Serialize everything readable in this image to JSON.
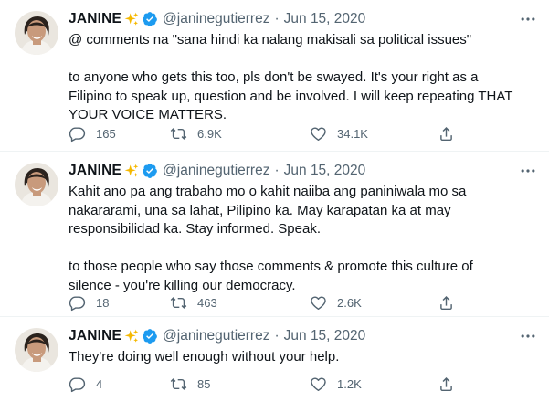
{
  "tweets": [
    {
      "name": "JANINE",
      "handle": "@janinegutierrez",
      "separator": "·",
      "date": "Jun 15, 2020",
      "lines": [
        "@ comments na \"sana hindi ka nalang makisali sa political issues\"",
        "",
        "to anyone who gets this too, pls don't be swayed. It's your right as a",
        "Filipino to speak up, question and be involved. I will keep repeating THAT",
        "YOUR VOICE MATTERS."
      ],
      "replies": "165",
      "retweets": "6.9K",
      "likes": "34.1K"
    },
    {
      "name": "JANINE",
      "handle": "@janinegutierrez",
      "separator": "·",
      "date": "Jun 15, 2020",
      "lines": [
        "Kahit ano pa ang trabaho mo o kahit naiiba ang paniniwala mo sa",
        "nakararami, una sa lahat, Pilipino ka. May karapatan ka at may",
        "responsibilidad ka. Stay informed. Speak.",
        "",
        "to those people who say those comments & promote this culture of",
        "silence - you're killing our democracy."
      ],
      "replies": "18",
      "retweets": "463",
      "likes": "2.6K"
    },
    {
      "name": "JANINE",
      "handle": "@janinegutierrez",
      "separator": "·",
      "date": "Jun 15, 2020",
      "lines": [
        "They're doing well enough without your help."
      ],
      "replies": "4",
      "retweets": "85",
      "likes": "1.2K"
    }
  ],
  "colors": {
    "text": "#0f1419",
    "secondary": "#536471",
    "verified": "#1d9bf0",
    "sparkle": "#f5b800",
    "divider": "#eff3f4"
  },
  "icons": [
    "sparkles-emoji-icon",
    "verified-badge-icon",
    "more-options-icon",
    "reply-icon",
    "retweet-icon",
    "like-icon",
    "share-icon"
  ]
}
